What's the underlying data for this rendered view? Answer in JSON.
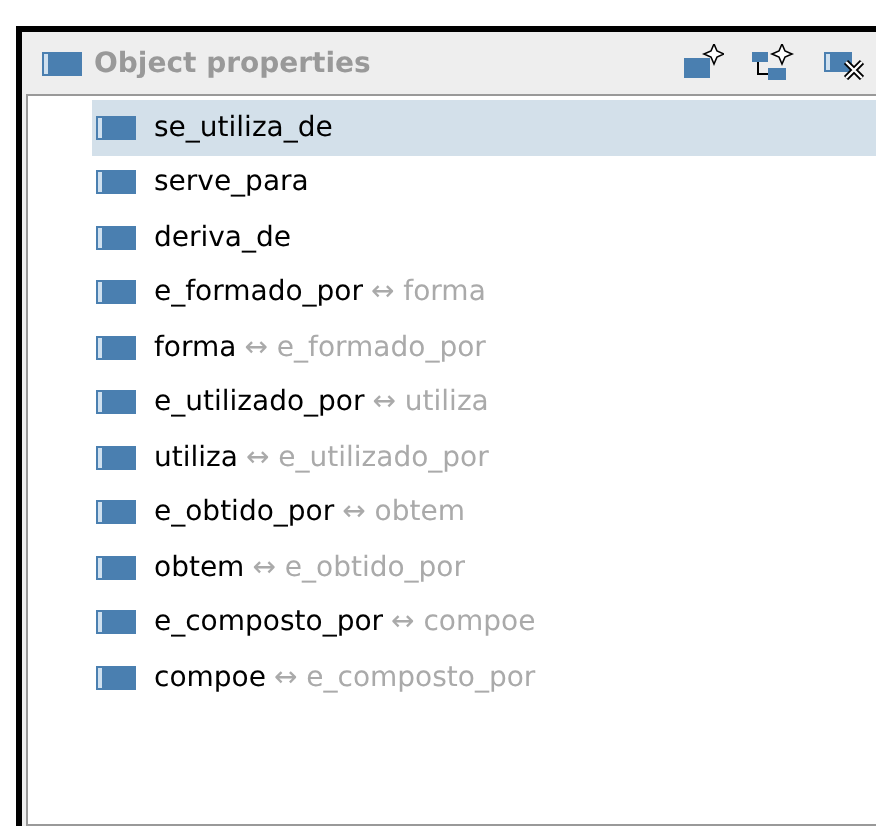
{
  "panel": {
    "title": "Object properties"
  },
  "properties": [
    {
      "name": "se_utiliza_de",
      "selected": true
    },
    {
      "name": "serve_para",
      "selected": false
    },
    {
      "name": "deriva_de",
      "selected": false
    },
    {
      "name": "e_formado_por",
      "inverse": "forma",
      "selected": false
    },
    {
      "name": "forma",
      "inverse": "e_formado_por",
      "selected": false
    },
    {
      "name": "e_utilizado_por",
      "inverse": "utiliza",
      "selected": false
    },
    {
      "name": "utiliza",
      "inverse": "e_utilizado_por",
      "selected": false
    },
    {
      "name": "e_obtido_por",
      "inverse": "obtem",
      "selected": false
    },
    {
      "name": "obtem",
      "inverse": "e_obtido_por",
      "selected": false
    },
    {
      "name": "e_composto_por",
      "inverse": "compoe",
      "selected": false
    },
    {
      "name": "compoe",
      "inverse": "e_composto_por",
      "selected": false
    }
  ],
  "inverse_symbol": "↔"
}
